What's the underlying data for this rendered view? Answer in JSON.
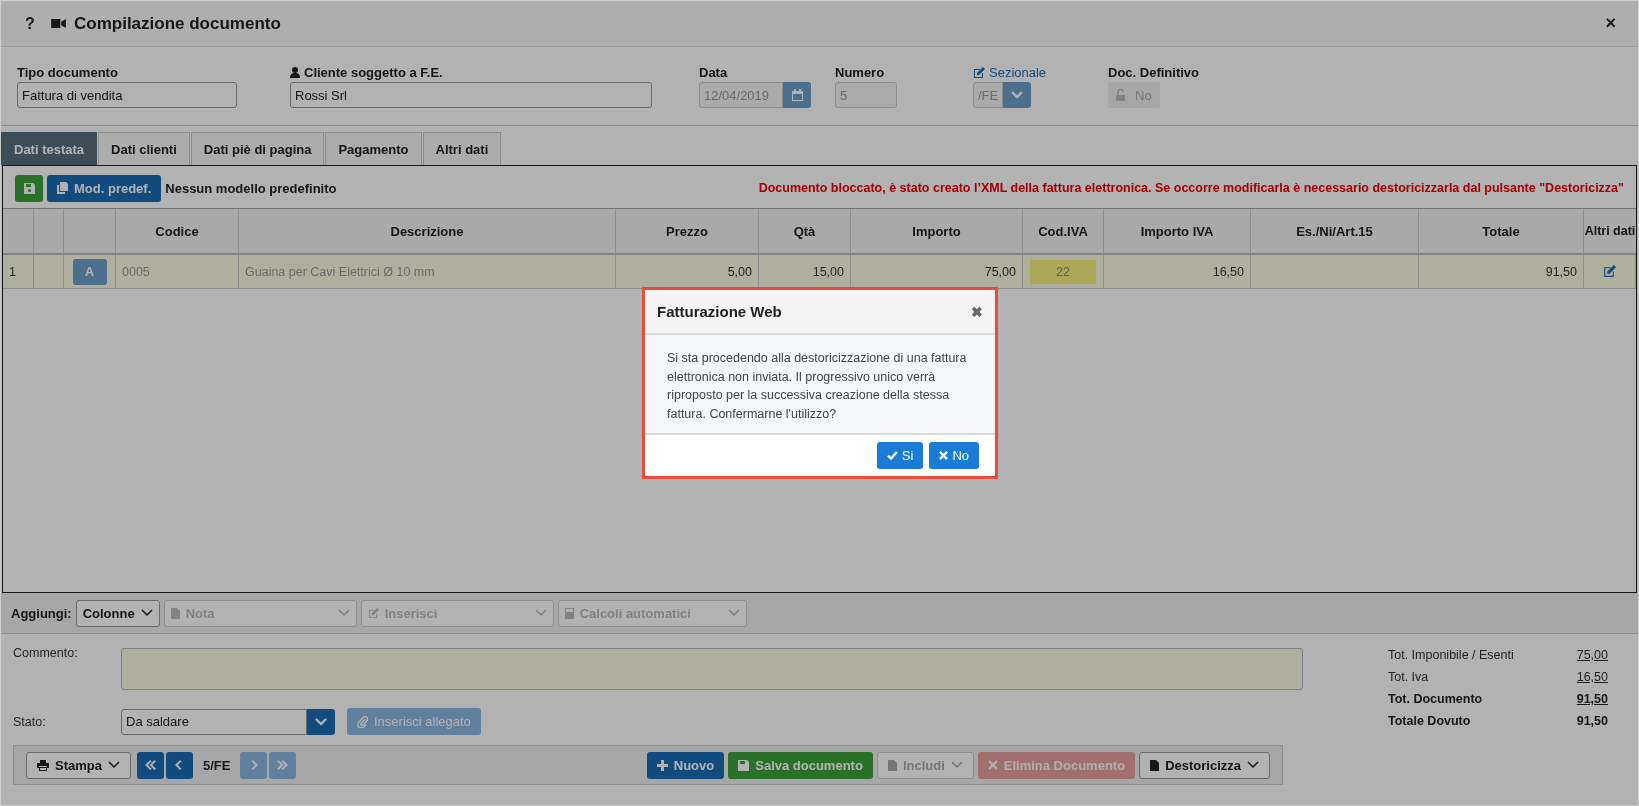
{
  "window": {
    "title": "Compilazione documento",
    "help": "?",
    "close": "×"
  },
  "document_type": {
    "label": "Tipo documento",
    "value": "Fattura di vendita"
  },
  "customer": {
    "label": "Cliente soggetto a F.E.",
    "value": "Rossi Srl"
  },
  "date": {
    "label": "Data",
    "value": "12/04/2019",
    "disabled": true
  },
  "number": {
    "label": "Numero",
    "value": "5",
    "disabled": true
  },
  "sezionale": {
    "label": "Sezionale",
    "value": "/FE"
  },
  "definitive": {
    "label": "Doc. Definitivo",
    "value": "No"
  },
  "tabs": [
    {
      "label": "Dati testata",
      "selected": true
    },
    {
      "label": "Dati clienti",
      "selected": false
    },
    {
      "label": "Dati piè di pagina",
      "selected": false
    },
    {
      "label": "Pagamento",
      "selected": false
    },
    {
      "label": "Altri dati",
      "selected": false
    }
  ],
  "toolbar": {
    "model_button": "Mod. predef.",
    "model_text": "Nessun modello predefinito",
    "warning": "Documento bloccato, è stato creato l’XML della fattura elettronica. Se occorre modificarla è necessario destoricizzarla dal pulsante \"Destoricizza\""
  },
  "table": {
    "columns": [
      "Codice",
      "Descrizione",
      "Prezzo",
      "Qtà",
      "Importo",
      "Cod.IVA",
      "Importo IVA",
      "Es./Ni/Art.15",
      "Totale",
      "Altri dati"
    ],
    "rows": [
      {
        "number": "1",
        "type_button": "A",
        "codice": "0005",
        "descrizione": "Guaina per Cavi Elettrici Ø 10 mm",
        "prezzo": "5,00",
        "qta": "15,00",
        "importo": "75,00",
        "cod_iva": "22",
        "importo_iva": "16,50",
        "totale": "91,50"
      }
    ]
  },
  "add_bar": {
    "label": "Aggiungi:",
    "dropdowns": [
      {
        "kind": "plain",
        "label": "Colonne",
        "disabled": false
      },
      {
        "kind": "note",
        "label": "Nota",
        "disabled": true
      },
      {
        "kind": "edit",
        "label": "Inserisci",
        "disabled": true
      },
      {
        "kind": "calculator",
        "label": "Calcoli automatici",
        "disabled": true
      }
    ]
  },
  "comment": {
    "label": "Commento:"
  },
  "status": {
    "label": "Stato:",
    "value": "Da saldare"
  },
  "attach_button": {
    "label": "Inserisci allegato",
    "disabled": true
  },
  "totals": [
    {
      "label": "Tot. Imponibile / Esenti",
      "value": "75,00",
      "bold": false,
      "underlined": true
    },
    {
      "label": "Tot. Iva",
      "value": "16,50",
      "bold": false,
      "underlined": true
    },
    {
      "label": "Tot. Documento",
      "value": "91,50",
      "bold": true,
      "underlined": true
    },
    {
      "label": "Totale Dovuto",
      "value": "91,50",
      "bold": true,
      "underlined": false
    }
  ],
  "footer": {
    "print": "Stampa",
    "nav": [
      {
        "kind": "first",
        "disabled": false
      },
      {
        "kind": "prev",
        "disabled": false
      }
    ],
    "position": "5/FE",
    "nav_after": [
      {
        "kind": "next",
        "disabled": true
      },
      {
        "kind": "last",
        "disabled": true
      }
    ],
    "buttons": [
      {
        "kind": "new",
        "label": "Nuovo",
        "disabled": false
      },
      {
        "kind": "save",
        "label": "Salva documento",
        "disabled": false
      },
      {
        "kind": "include",
        "label": "Includi",
        "disabled": true
      },
      {
        "kind": "delete",
        "label": "Elimina Documento",
        "disabled": true
      },
      {
        "kind": "unstore",
        "label": "Destoricizza",
        "disabled": false
      }
    ]
  },
  "dialog": {
    "title": "Fatturazione Web",
    "close": "✖",
    "message": "Si sta procedendo alla destoricizzazione di una fattura elettronica non inviata. Il progressivo unico verrà riproposto per la successiva creazione della stessa fattura. Confermarne l'utilizzo?",
    "buttons": [
      {
        "kind": "confirm",
        "label": "Si"
      },
      {
        "kind": "cancel",
        "label": "No"
      }
    ]
  }
}
